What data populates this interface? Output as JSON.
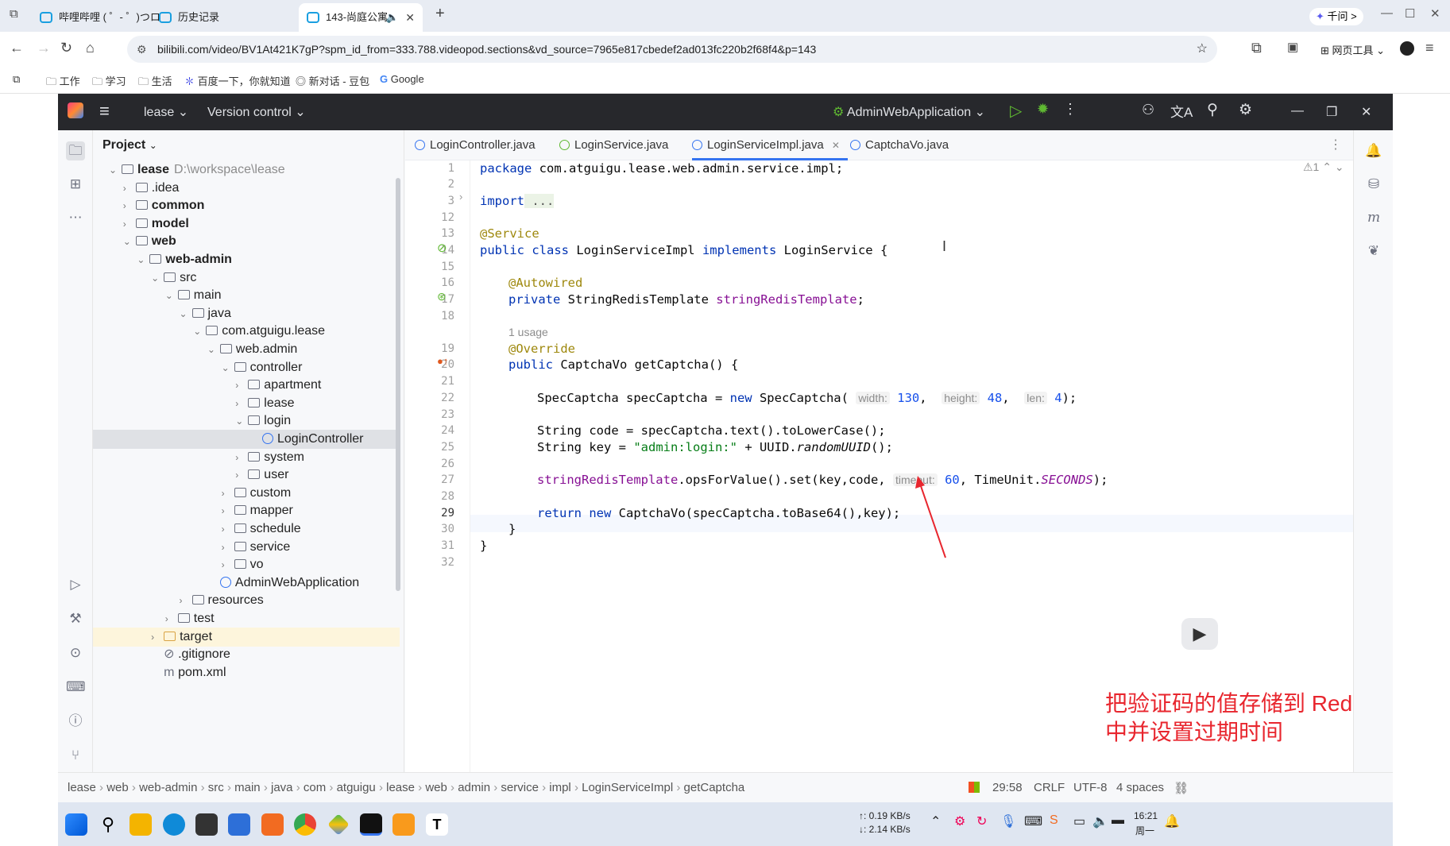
{
  "browser": {
    "tabs": [
      {
        "label": "哔哩哔哩 ( ゜- ゜)つロ"
      },
      {
        "label": "历史记录"
      },
      {
        "label": "143-尚庭公寓"
      }
    ],
    "new_tab": "+",
    "profile": "千问 >",
    "url": "bilibili.com/video/BV1At421K7gP?spm_id_from=333.788.videopod.sections&vd_source=7965e817cbedef2ad013fc220b2f68f4&p=143",
    "web_tools": "网页工具",
    "bookmarks": [
      "工作",
      "学习",
      "生活",
      "百度一下，你就知道",
      "新对话 - 豆包",
      "Google"
    ]
  },
  "ide": {
    "project_name": "lease",
    "vcs": "Version control",
    "run_config": "AdminWebApplication",
    "panel_title": "Project",
    "tree": [
      {
        "label": "lease",
        "path": "D:\\workspace\\lease",
        "bold": true
      },
      {
        "label": ".idea"
      },
      {
        "label": "common",
        "bold": true
      },
      {
        "label": "model",
        "bold": true
      },
      {
        "label": "web",
        "bold": true
      },
      {
        "label": "web-admin",
        "bold": true
      },
      {
        "label": "src"
      },
      {
        "label": "main"
      },
      {
        "label": "java"
      },
      {
        "label": "com.atguigu.lease"
      },
      {
        "label": "web.admin"
      },
      {
        "label": "controller"
      },
      {
        "label": "apartment"
      },
      {
        "label": "lease"
      },
      {
        "label": "login"
      },
      {
        "label": "LoginController"
      },
      {
        "label": "system"
      },
      {
        "label": "user"
      },
      {
        "label": "custom"
      },
      {
        "label": "mapper"
      },
      {
        "label": "schedule"
      },
      {
        "label": "service"
      },
      {
        "label": "vo"
      },
      {
        "label": "AdminWebApplication"
      },
      {
        "label": "resources"
      },
      {
        "label": "test"
      },
      {
        "label": "target"
      },
      {
        "label": ".gitignore"
      },
      {
        "label": "pom.xml"
      }
    ],
    "editor_tabs": [
      "LoginController.java",
      "LoginService.java",
      "LoginServiceImpl.java",
      "CaptchaVo.java"
    ],
    "problems": "⚠1",
    "line_numbers": [
      "1",
      "2",
      "3",
      "12",
      "13",
      "14",
      "15",
      "16",
      "17",
      "18",
      "19",
      "20",
      "21",
      "22",
      "23",
      "24",
      "25",
      "26",
      "27",
      "28",
      "29",
      "30",
      "31",
      "32"
    ],
    "code": {
      "l1a": "package",
      "l1b": " com.atguigu.lease.web.admin.service.impl;",
      "l3a": "import",
      "l3b": " ...",
      "l13": "@Service",
      "l14a": "public class",
      "l14b": " LoginServiceImpl ",
      "l14c": "implements",
      "l14d": " LoginService {",
      "l16": "@Autowired",
      "l17a": "private",
      "l17b": " StringRedisTemplate ",
      "l17c": "stringRedisTemplate",
      "l17d": ";",
      "usage": "1 usage",
      "l19": "@Override",
      "l20a": "public",
      "l20b": " CaptchaVo getCaptcha() {",
      "l22a": "SpecCaptcha specCaptcha = ",
      "l22b": "new",
      "l22c": " SpecCaptcha(",
      "h_width": "width:",
      "v_width": "130",
      "h_height": "height:",
      "v_height": "48",
      "h_len": "len:",
      "v_len": "4",
      "l22end": ");",
      "l24": "String code = specCaptcha.text().toLowerCase();",
      "l25a": "String key = ",
      "l25b": "\"admin:login:\"",
      "l25c": " + UUID.",
      "l25d": "randomUUID",
      "l25e": "();",
      "l27a": "stringRedisTemplate",
      "l27b": ".opsForValue().set(key,code, ",
      "h_timeout": "timeout:",
      "v_timeout": "60",
      "l27c": ", TimeUnit.",
      "l27d": "SECONDS",
      "l27e": ");",
      "l29a": "return",
      "l29b": " new",
      "l29c": " CaptchaVo(specCaptcha.toBase64(),key);",
      "l30": "}",
      "l31": "}"
    },
    "annotation": [
      "把验证码的值存储到 Redis",
      "中并设置过期时间"
    ],
    "breadcrumb": [
      "lease",
      "web",
      "web-admin",
      "src",
      "main",
      "java",
      "com",
      "atguigu",
      "lease",
      "web",
      "admin",
      "service",
      "impl",
      "LoginServiceImpl",
      "getCaptcha"
    ],
    "status": {
      "position": "29:58",
      "line_sep": "CRLF",
      "encoding": "UTF-8",
      "indent": "4 spaces"
    }
  },
  "taskbar": {
    "net_up": "↑: 0.19 KB/s",
    "net_down": "↓: 2.14 KB/s",
    "time": "16:21",
    "day": "周一"
  }
}
